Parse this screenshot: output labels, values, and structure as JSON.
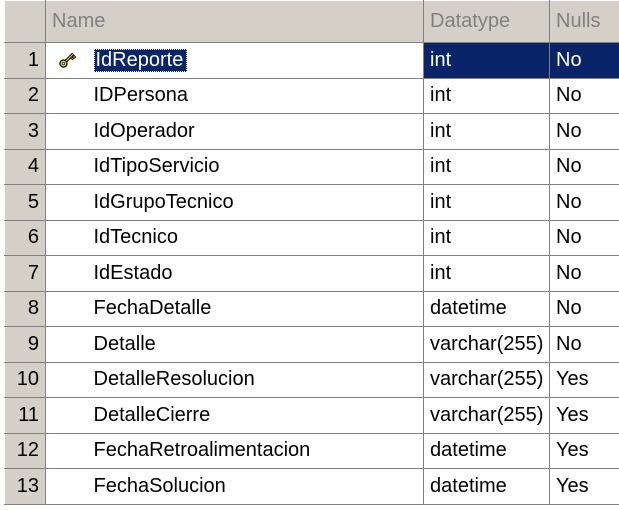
{
  "columns": {
    "name": "Name",
    "datatype": "Datatype",
    "nulls": "Nulls"
  },
  "rows": [
    {
      "num": "1",
      "name": "IdReporte",
      "datatype": "int",
      "nulls": "No",
      "primary_key": true,
      "selected": true
    },
    {
      "num": "2",
      "name": "IDPersona",
      "datatype": "int",
      "nulls": "No"
    },
    {
      "num": "3",
      "name": "IdOperador",
      "datatype": "int",
      "nulls": "No"
    },
    {
      "num": "4",
      "name": "IdTipoServicio",
      "datatype": "int",
      "nulls": "No"
    },
    {
      "num": "5",
      "name": "IdGrupoTecnico",
      "datatype": "int",
      "nulls": "No"
    },
    {
      "num": "6",
      "name": "IdTecnico",
      "datatype": "int",
      "nulls": "No"
    },
    {
      "num": "7",
      "name": "IdEstado",
      "datatype": "int",
      "nulls": "No"
    },
    {
      "num": "8",
      "name": "FechaDetalle",
      "datatype": "datetime",
      "nulls": "No"
    },
    {
      "num": "9",
      "name": "Detalle",
      "datatype": "varchar(255)",
      "nulls": "No"
    },
    {
      "num": "10",
      "name": "DetalleResolucion",
      "datatype": "varchar(255)",
      "nulls": "Yes"
    },
    {
      "num": "11",
      "name": "DetalleCierre",
      "datatype": "varchar(255)",
      "nulls": "Yes"
    },
    {
      "num": "12",
      "name": "FechaRetroalimentacion",
      "datatype": "datetime",
      "nulls": "Yes"
    },
    {
      "num": "13",
      "name": "FechaSolucion",
      "datatype": "datetime",
      "nulls": "Yes"
    }
  ],
  "icons": {
    "primary_key": "key-icon"
  },
  "colors": {
    "header_bg": "#d4d0c8",
    "header_text": "#808080",
    "selection_bg": "#0a246a",
    "selection_text": "#ffffff",
    "grid_line": "#808080"
  }
}
